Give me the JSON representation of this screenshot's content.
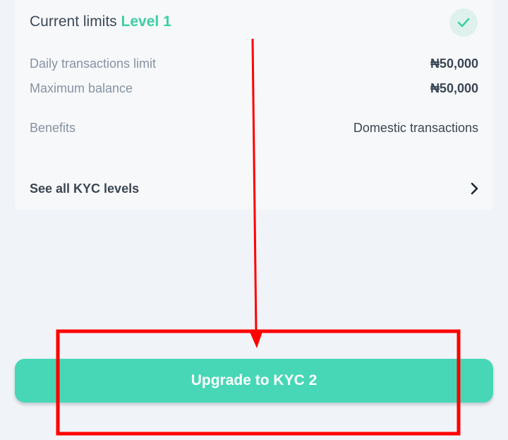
{
  "limits_card": {
    "title_prefix": "Current limits",
    "level_label": "Level 1",
    "status_icon": "check-icon",
    "rows": [
      {
        "label": "Daily transactions limit",
        "value": "₦50,000"
      },
      {
        "label": "Maximum balance",
        "value": "₦50,000"
      },
      {
        "label": "Benefits",
        "value": "Domestic transactions"
      }
    ],
    "see_all_label": "See all KYC levels",
    "see_all_icon": "chevron-right-icon"
  },
  "upgrade_button": {
    "label": "Upgrade to KYC 2"
  },
  "annotation": {
    "color": "#ff0000",
    "shapes": [
      "arrow-down",
      "highlight-rectangle"
    ]
  },
  "colors": {
    "background": "#f0f3f7",
    "card": "#f7f8fa",
    "accent": "#47d7b6",
    "level_text": "#3ccfa4"
  }
}
